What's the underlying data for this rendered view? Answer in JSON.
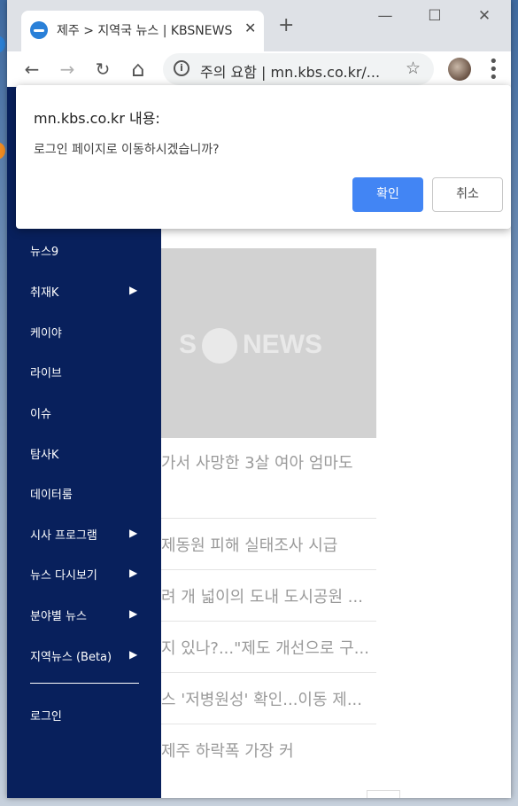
{
  "browser": {
    "tab_title": "제주 > 지역국 뉴스 | KBSNEWS",
    "tab_close": "✕",
    "new_tab": "+",
    "minimize": "—",
    "maximize": "☐",
    "close": "✕",
    "back": "←",
    "forward": "→",
    "reload": "↻",
    "home": "⌂",
    "address": "주의 요함 | mn.kbs.co.kr/...",
    "bookmark": "☆",
    "menu": "⋮",
    "colors": {
      "titlebar": "#dee1e6",
      "accent": "#4285f4"
    }
  },
  "dialog": {
    "title": "mn.kbs.co.kr 내용:",
    "message": "로그인 페이지로 이동하시겠습니까?",
    "ok_label": "확인",
    "cancel_label": "취소"
  },
  "sidebar": {
    "items": [
      {
        "label": "뉴스9",
        "has_arrow": false
      },
      {
        "label": "취재K",
        "has_arrow": true
      },
      {
        "label": "케이야",
        "has_arrow": false
      },
      {
        "label": "라이브",
        "has_arrow": false
      },
      {
        "label": "이슈",
        "has_arrow": false
      },
      {
        "label": "탐사K",
        "has_arrow": false
      },
      {
        "label": "데이터룸",
        "has_arrow": false
      },
      {
        "label": "시사 프로그램",
        "has_arrow": true
      },
      {
        "label": "뉴스 다시보기",
        "has_arrow": true
      },
      {
        "label": "분야별 뉴스",
        "has_arrow": true
      },
      {
        "label": "지역뉴스 (Beta)",
        "has_arrow": true
      }
    ],
    "arrow": "▶",
    "login": "로그인",
    "color": "#08205c"
  },
  "main": {
    "thumb_logo_left": "S",
    "thumb_logo_right": "NEWS",
    "headline": "가서 사망한 3살 여아 엄마도",
    "news": [
      "제동원 피해 실태조사 시급",
      "려 개 넓이의 도내 도시공원 ...",
      "지 있나?...\"제도 개선으로 구...",
      "스 '저병원성' 확인...이동 제...",
      "제주 하락폭 가장 커"
    ]
  }
}
